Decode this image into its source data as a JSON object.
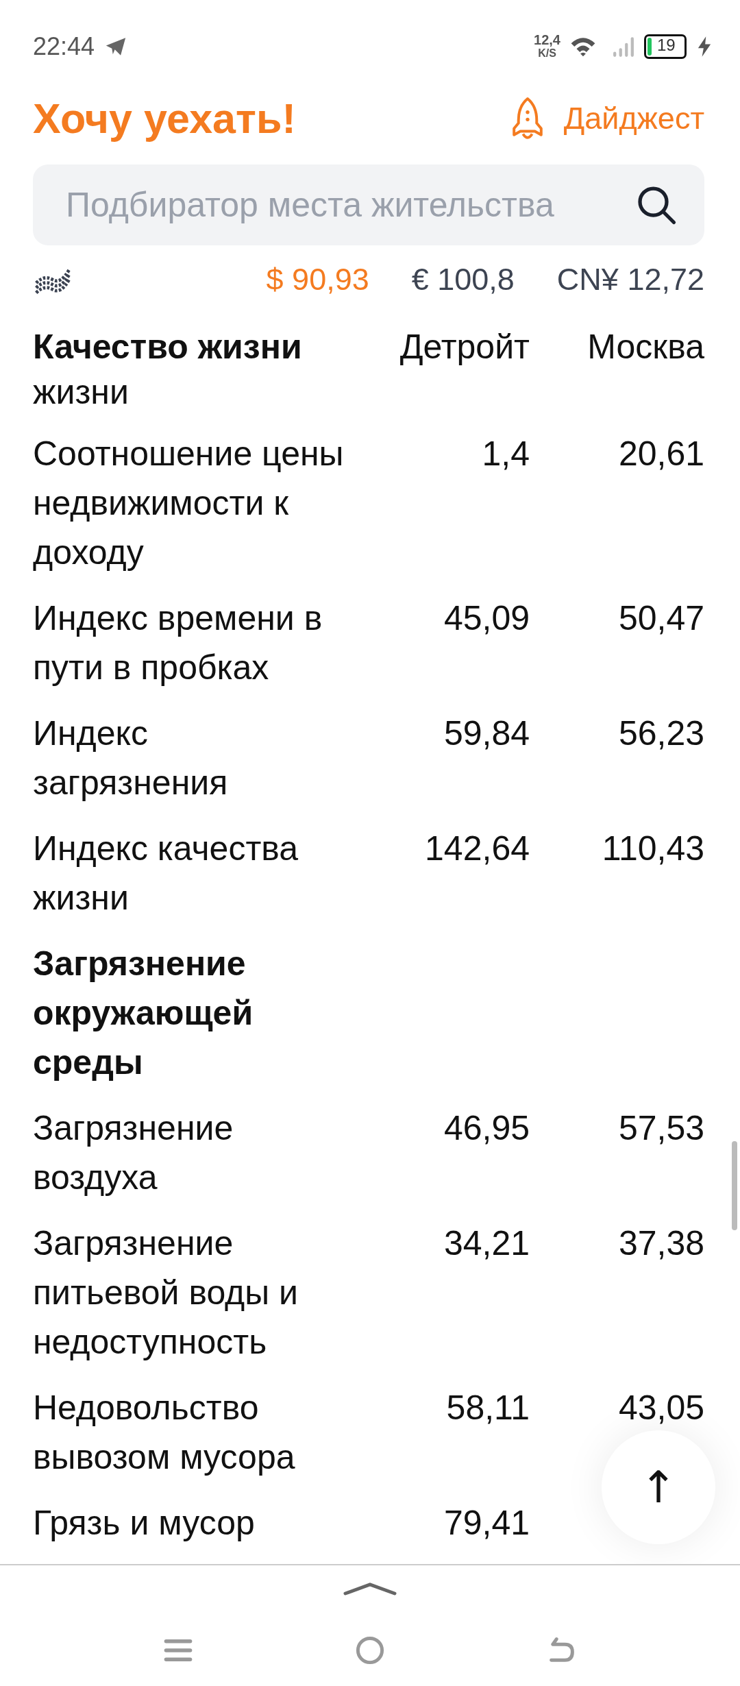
{
  "status_bar": {
    "time": "22:44",
    "speed_value": "12,4",
    "speed_unit": "K/S",
    "battery": "19",
    "charging": true
  },
  "header": {
    "title": "Хочу уехать!",
    "digest_link": "Дайджест"
  },
  "search": {
    "placeholder": "Подбиратор места жительства"
  },
  "currencies": [
    {
      "label": "$ 90,93",
      "selected": true
    },
    {
      "label": "€ 100,8",
      "selected": false
    },
    {
      "label": "CN¥ 12,72",
      "selected": false
    }
  ],
  "table": {
    "title": "Качество жизни",
    "subtitle": "жизни",
    "columns": [
      "Детройт",
      "Москва"
    ],
    "rows": [
      {
        "kind": "row",
        "label": "Соотношение цены недвижимости к доходу",
        "values": [
          "1,4",
          "20,61"
        ]
      },
      {
        "kind": "row",
        "label": "Индекс времени в пути в пробках",
        "values": [
          "45,09",
          "50,47"
        ]
      },
      {
        "kind": "row",
        "label": "Индекс загрязнения",
        "values": [
          "59,84",
          "56,23"
        ]
      },
      {
        "kind": "row",
        "label": "Индекс качества жизни",
        "values": [
          "142,64",
          "110,43"
        ]
      },
      {
        "kind": "heading",
        "label": "Загрязнение окружающей среды"
      },
      {
        "kind": "row",
        "label": "Загрязнение воздуха",
        "values": [
          "46,95",
          "57,53"
        ]
      },
      {
        "kind": "row",
        "label": "Загрязнение питьевой воды и недоступность",
        "values": [
          "34,21",
          "37,38"
        ]
      },
      {
        "kind": "row",
        "label": "Недовольство вывозом мусора",
        "values": [
          "58,11",
          "43,05"
        ]
      },
      {
        "kind": "row",
        "label": "Грязь и мусор",
        "values": [
          "79,41"
        ]
      }
    ]
  },
  "scroll_top_button": {
    "label": "↑"
  }
}
